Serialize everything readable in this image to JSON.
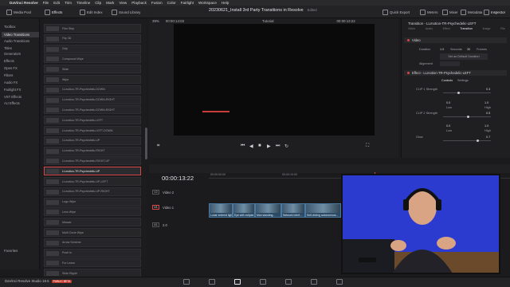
{
  "menubar": {
    "app_name": "DaVinci Resolve",
    "items": [
      "File",
      "Edit",
      "Trim",
      "Timeline",
      "Clip",
      "Mark",
      "View",
      "Playback",
      "Fusion",
      "Color",
      "Fairlight",
      "Workspace",
      "Help"
    ]
  },
  "toolbar": {
    "media_pool": "Media Pool",
    "effects": "Effects",
    "edit_index": "Edit Index",
    "sound_library": "Sound Library",
    "project_title": "20230621_Install 3rd Party Transitions in Resolve",
    "edited": "Edited",
    "quick_export": "Quick Export",
    "meters": "Meters",
    "mixer": "Mixer",
    "metadata": "Metadata",
    "inspector": "Inspector"
  },
  "sidebar": {
    "items": [
      "Toolbox",
      "Video Transitions",
      "Audio Transitions",
      "Titles",
      "Generators",
      "Effects",
      "Open FX",
      "Filters",
      "Audio FX",
      "Fairlight FX",
      "VST Effects",
      "AU Effects"
    ],
    "favorites": "Favorites"
  },
  "effects_list": {
    "items": [
      "Film Strip",
      "Flip 3D",
      "Grip",
      "Compound Wipe",
      "Slide",
      "Wipe",
      "LLmotion-TR-Psychedelic-DOWN",
      "LLmotion-TR-Psychedelic-DOWN-RIGHT",
      "LLmotion-TR-Psychedelic-DOWN-RIGHT",
      "LLmotion-TR-Psychedelic-LEFT",
      "LLmotion-TR-Psychedelic-LEFT-DOWN",
      "LLmotion-TR-Psychedelic-UP",
      "LLmotion-TR-Psychedelic-RIGHT",
      "LLmotion-TR-Psychedelic-RIGHT-UP",
      "LLmotion-TR-Psychedelic-UP",
      "LLmotion-TR-Psychedelic-UP-LEFT",
      "LLmotion-TR-Psychedelic-UP-RIGHT",
      "Logo Wipe",
      "Lens Wipe",
      "Mosaic",
      "Multi Circle Wipe",
      "Arrow Scheme",
      "Push In",
      "For Leave",
      "Slide Ripple"
    ],
    "selected_index": 14
  },
  "viewer": {
    "zoom": "39%",
    "timecode": "00:00:14:03",
    "timeline_name": "Tutorial",
    "end_timecode": "00:00:13:22"
  },
  "inspector": {
    "title": "Transition - LLmotion-TR-Psychedelic-LEFT",
    "tabs": [
      "Video",
      "Audio",
      "Effect",
      "Transition",
      "Image",
      "File"
    ],
    "active_tab": "Transition",
    "video_section": "Video",
    "duration_label": "Duration",
    "duration_value": "1.0",
    "seconds_label": "Seconds",
    "frames_value": "30",
    "frames_label": "Frames",
    "set_default": "Set as Default Duration",
    "alignment_label": "Alignment",
    "effect_section": "Effect - LLmotion-TR-Psychedelic-LEFT",
    "sub_tabs": [
      "Controls",
      "Settings"
    ],
    "controls": [
      {
        "label": "CLIP 1 Strength",
        "value": "0.3"
      },
      {
        "label": "",
        "value": "0.0"
      },
      {
        "label": "Low",
        "value": ""
      },
      {
        "label": "CLIP 2 Strength",
        "value": "0.5"
      },
      {
        "label": "",
        "value": "0.0"
      },
      {
        "label": "Low",
        "value": ""
      },
      {
        "label": "Glow",
        "value": "0.7"
      }
    ],
    "high_label": "High",
    "one_label": "1.0"
  },
  "timeline": {
    "timecode": "00:00:13:22",
    "ruler_marks": [
      "00:00:00:00",
      "00:00:10:00"
    ],
    "tracks": [
      {
        "badge": "V2",
        "name": "Video 2"
      },
      {
        "badge": "V1",
        "name": "Video 1"
      },
      {
        "badge": "A1",
        "name": "2.0"
      }
    ],
    "clips": [
      "Lunar entered light...",
      "Eye with eclipse...",
      "Man standing...",
      "Network interf...",
      "Self-driving autonomous..."
    ]
  },
  "bottombar": {
    "app_label": "DaVinci Resolve Studio 18.5",
    "beta_label": "PUBLIC BETA"
  },
  "colors": {
    "accent_red": "#d94545",
    "clip_blue": "#2a4a66",
    "webcam_bg": "#2b3bd0"
  }
}
